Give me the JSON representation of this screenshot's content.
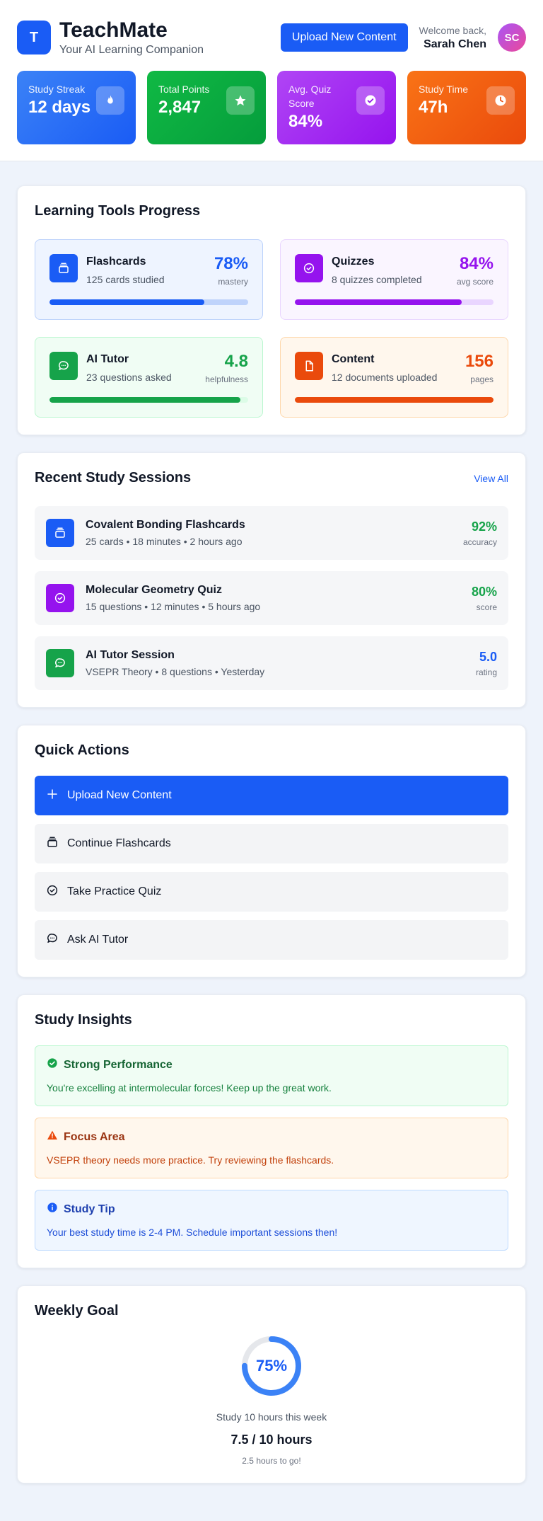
{
  "app": {
    "logo_letter": "T",
    "title": "TeachMate",
    "subtitle": "Your AI Learning Companion"
  },
  "header": {
    "upload_label": "Upload New Content",
    "welcome": "Welcome back,",
    "user_name": "Sarah Chen",
    "avatar_initials": "SC"
  },
  "stats": [
    {
      "label": "Study Streak",
      "value": "12 days",
      "icon": "flame-icon"
    },
    {
      "label": "Total Points",
      "value": "2,847",
      "icon": "star-icon"
    },
    {
      "label": "Avg. Quiz Score",
      "value": "84%",
      "icon": "check-circle-icon"
    },
    {
      "label": "Study Time",
      "value": "47h",
      "icon": "clock-icon"
    }
  ],
  "tools": {
    "title": "Learning Tools Progress",
    "items": [
      {
        "name": "Flashcards",
        "desc": "125 cards studied",
        "metric": "78%",
        "metric_label": "mastery",
        "progress": 0.78,
        "color": "#1a5cf5",
        "icon": "cards-icon"
      },
      {
        "name": "Quizzes",
        "desc": "8 quizzes completed",
        "metric": "84%",
        "metric_label": "avg score",
        "progress": 0.84,
        "color": "#9513ee",
        "icon": "check-circle-icon"
      },
      {
        "name": "AI Tutor",
        "desc": "23 questions asked",
        "metric": "4.8",
        "metric_label": "helpfulness",
        "progress": 0.96,
        "color": "#16a34a",
        "icon": "chat-icon"
      },
      {
        "name": "Content",
        "desc": "12 documents uploaded",
        "metric": "156",
        "metric_label": "pages",
        "progress": 1.0,
        "color": "#ea4a0c",
        "icon": "document-icon"
      }
    ]
  },
  "sessions": {
    "title": "Recent Study Sessions",
    "view_all": "View All",
    "items": [
      {
        "title": "Covalent Bonding Flashcards",
        "meta": "25 cards • 18 minutes • 2 hours ago",
        "metric": "92%",
        "metric_label": "accuracy",
        "color": "#16a34a",
        "icon": "cards-icon"
      },
      {
        "title": "Molecular Geometry Quiz",
        "meta": "15 questions • 12 minutes • 5 hours ago",
        "metric": "80%",
        "metric_label": "score",
        "color": "#16a34a",
        "icon": "check-circle-icon"
      },
      {
        "title": "AI Tutor Session",
        "meta": "VSEPR Theory • 8 questions • Yesterday",
        "metric": "5.0",
        "metric_label": "rating",
        "color": "#1a5cf5",
        "icon": "chat-icon"
      }
    ]
  },
  "quick_actions": {
    "title": "Quick Actions",
    "items": [
      {
        "label": "Upload New Content",
        "icon": "plus-icon"
      },
      {
        "label": "Continue Flashcards",
        "icon": "cards-icon"
      },
      {
        "label": "Take Practice Quiz",
        "icon": "check-circle-icon"
      },
      {
        "label": "Ask AI Tutor",
        "icon": "chat-icon"
      }
    ]
  },
  "insights": {
    "title": "Study Insights",
    "items": [
      {
        "title": "Strong Performance",
        "body": "You're excelling at intermolecular forces! Keep up the great work.",
        "icon": "check-circle-icon"
      },
      {
        "title": "Focus Area",
        "body": "VSEPR theory needs more practice. Try reviewing the flashcards.",
        "icon": "warning-icon"
      },
      {
        "title": "Study Tip",
        "body": "Your best study time is 2-4 PM. Schedule important sessions then!",
        "icon": "info-icon"
      }
    ]
  },
  "weekly_goal": {
    "title": "Weekly Goal",
    "percent_label": "75%",
    "progress": 0.75,
    "goal_text": "Study 10 hours this week",
    "value_text": "7.5 / 10 hours",
    "remaining": "2.5 hours to go!"
  },
  "colors": {
    "primary": "#1a5cf5",
    "success": "#16a34a",
    "purple": "#9513ee",
    "orange": "#ea4a0c"
  }
}
